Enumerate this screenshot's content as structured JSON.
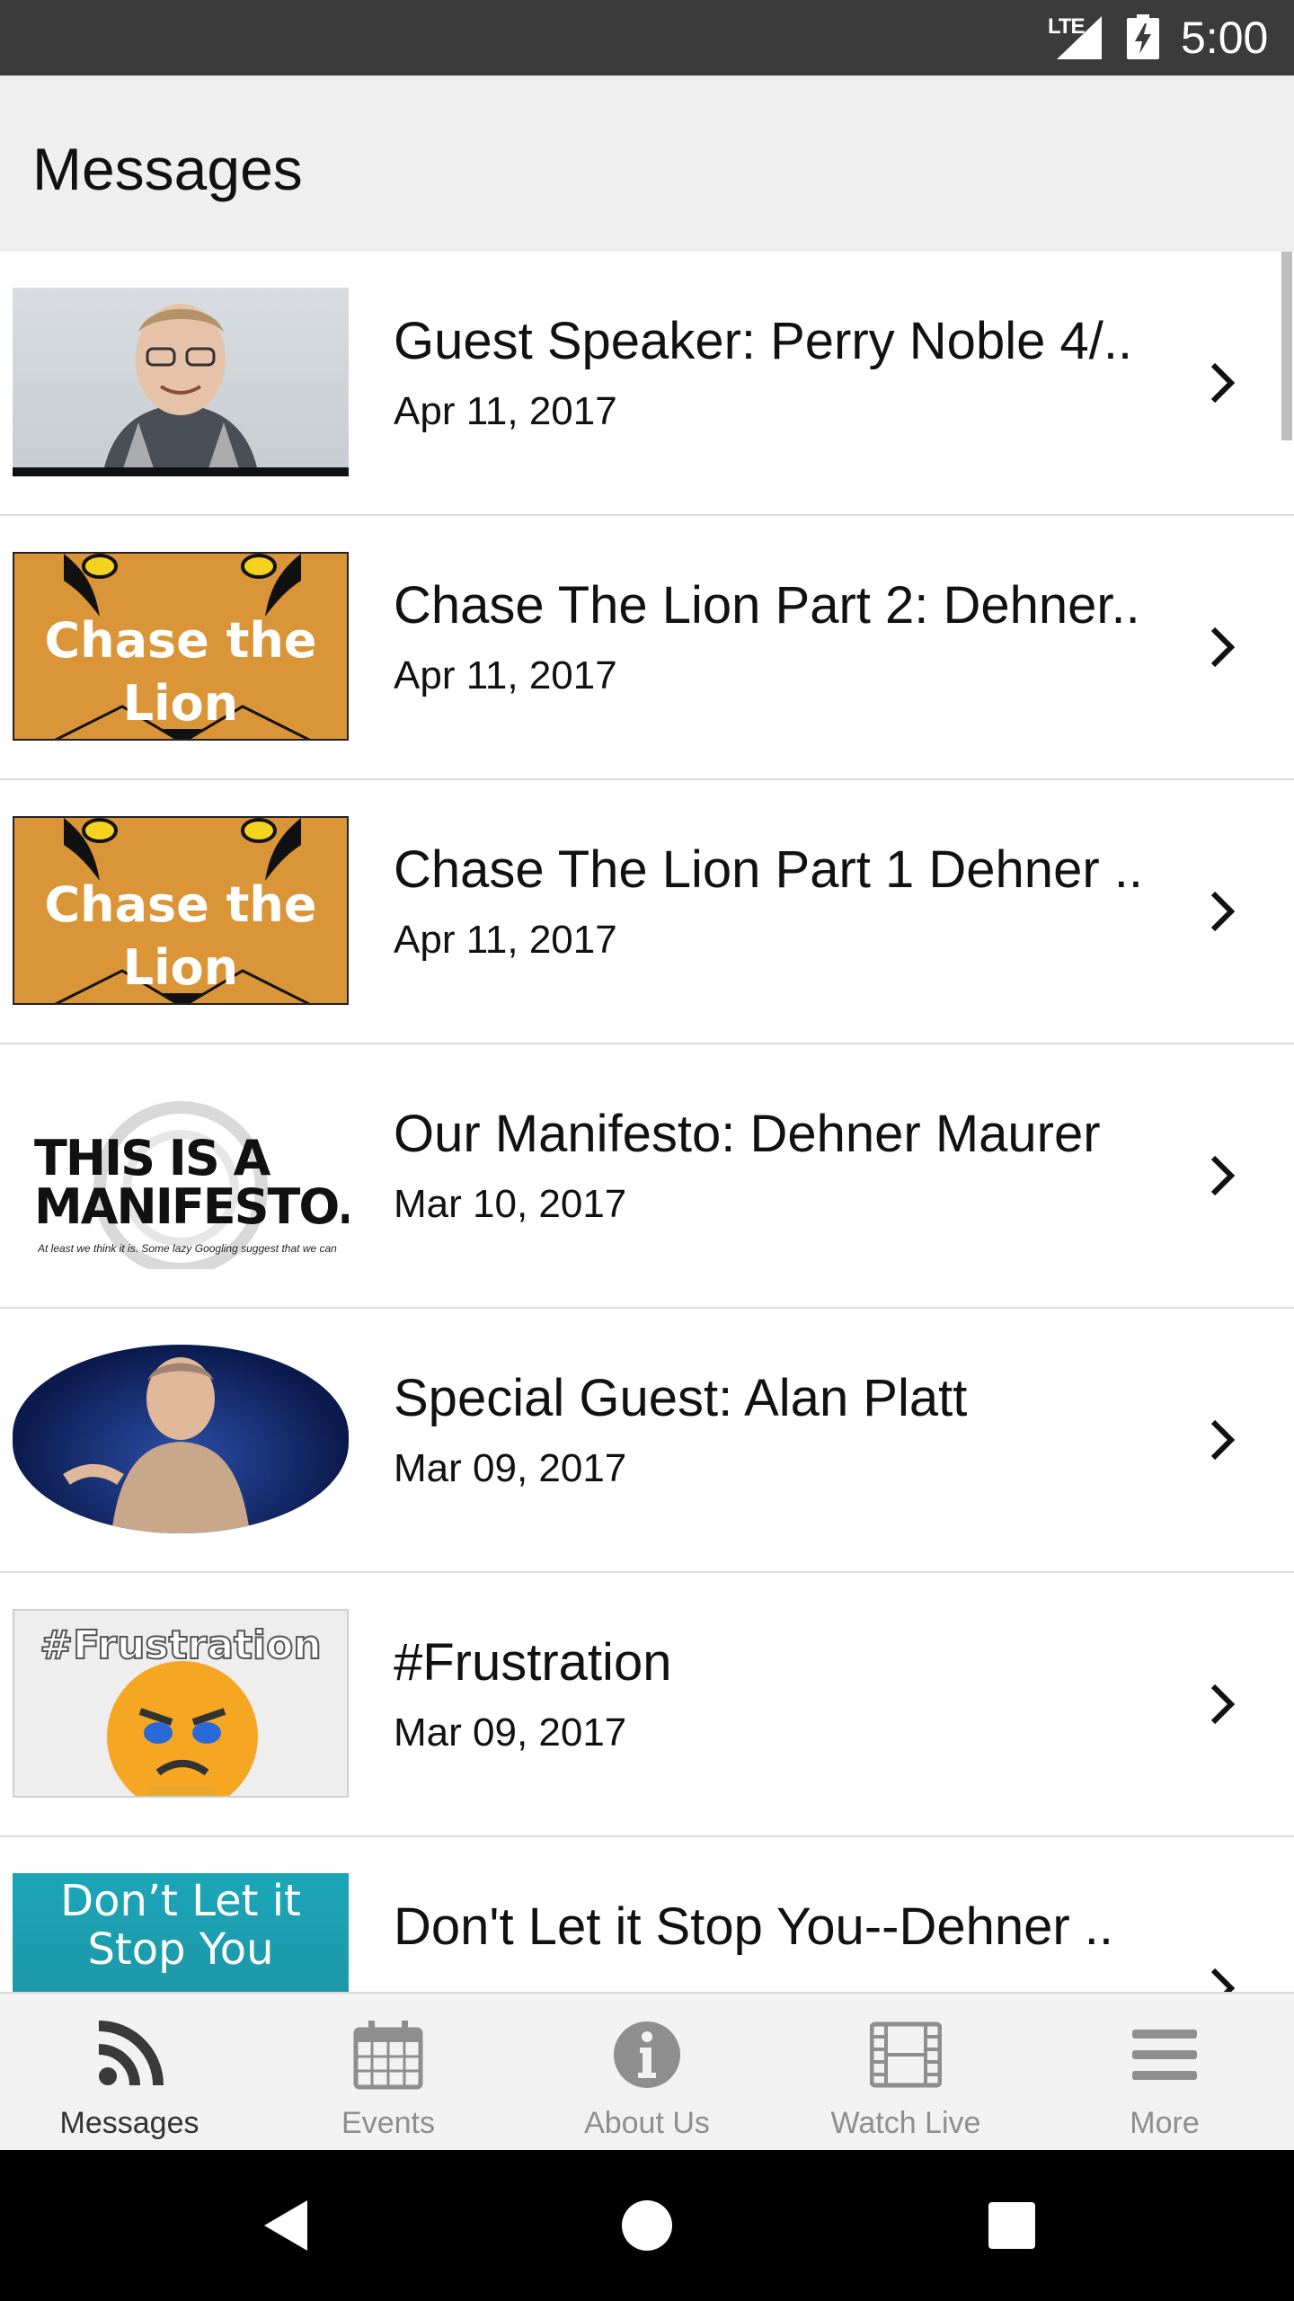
{
  "status_bar": {
    "network": "LTE",
    "time": "5:00"
  },
  "app_bar": {
    "title": "Messages"
  },
  "messages": [
    {
      "title": "Guest Speaker: Perry Noble 4/..",
      "date": "Apr 11, 2017",
      "thumb": "speaker-photo"
    },
    {
      "title": "Chase The Lion Part 2: Dehner..",
      "date": "Apr 11, 2017",
      "thumb": "lion-graphic",
      "thumb_text_1": "Chase the",
      "thumb_text_2": "Lion"
    },
    {
      "title": "Chase The Lion Part 1 Dehner ..",
      "date": "Apr 11, 2017",
      "thumb": "lion-graphic",
      "thumb_text_1": "Chase the",
      "thumb_text_2": "Lion"
    },
    {
      "title": "Our Manifesto: Dehner Maurer",
      "date": "Mar 10, 2017",
      "thumb": "manifesto-graphic",
      "thumb_text_1": "THIS IS A",
      "thumb_text_2": "MANIFESTO.",
      "thumb_caption": "At least we think it is. Some lazy Googling suggest that we can"
    },
    {
      "title": "Special Guest: Alan Platt",
      "date": "Mar 09, 2017",
      "thumb": "stage-photo"
    },
    {
      "title": "#Frustration",
      "date": "Mar 09, 2017",
      "thumb": "frustration-graphic",
      "thumb_text_1": "#Frustration"
    },
    {
      "title": "Don't Let it Stop You--Dehner ..",
      "date": "",
      "thumb": "dont-let-graphic",
      "thumb_text_1": "Don’t Let it",
      "thumb_text_2": "Stop You"
    }
  ],
  "bottom_nav": [
    {
      "label": "Messages",
      "icon": "rss-icon",
      "active": true
    },
    {
      "label": "Events",
      "icon": "calendar-icon",
      "active": false
    },
    {
      "label": "About Us",
      "icon": "info-icon",
      "active": false
    },
    {
      "label": "Watch Live",
      "icon": "film-icon",
      "active": false
    },
    {
      "label": "More",
      "icon": "menu-icon",
      "active": false
    }
  ],
  "colors": {
    "status_bar": "#3b3b3b",
    "app_bar": "#efefef",
    "nav_active": "#333333",
    "nav_inactive": "#8e8e8e",
    "lion_orange": "#d99538"
  }
}
